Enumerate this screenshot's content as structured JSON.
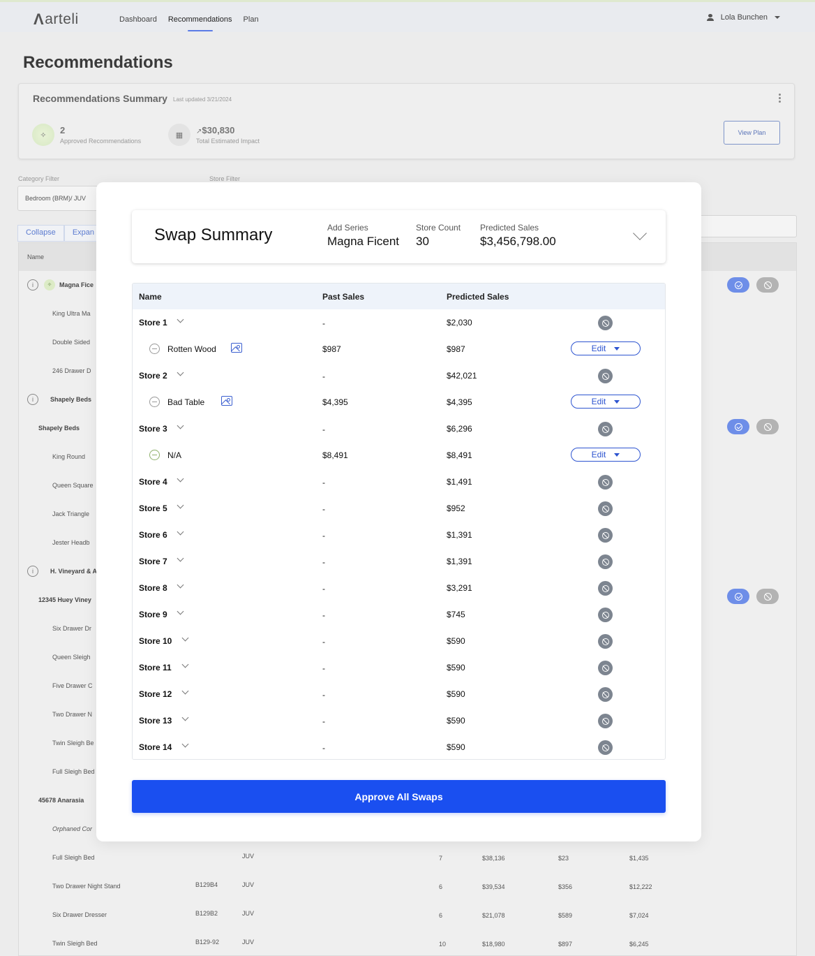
{
  "brand": {
    "name": "arteli"
  },
  "nav": {
    "items": [
      "Dashboard",
      "Recommendations",
      "Plan"
    ],
    "active": "Recommendations"
  },
  "user": {
    "name": "Lola Bunchen"
  },
  "page": {
    "title": "Recommendations"
  },
  "summary": {
    "title": "Recommendations Summary",
    "updated": "Last updated 3/21/2024",
    "approved_count": "2",
    "approved_label": "Approved Recommendations",
    "impact_value": "$30,830",
    "impact_label": "Total Estimated Impact",
    "view_plan": "View Plan"
  },
  "filters": {
    "category_label": "Category Filter",
    "category_value": "Bedroom (BRM)/ JUV",
    "store_label": "Store Filter",
    "collapse": "Collapse",
    "expand": "Expan"
  },
  "bg_table": {
    "name_header": "Name",
    "rows": [
      {
        "name": "Magna Fice",
        "style": "group-spark"
      },
      {
        "name": "King Ultra Ma",
        "style": "item"
      },
      {
        "name": "Double Sided",
        "style": "item"
      },
      {
        "name": "246 Drawer D",
        "style": "item"
      },
      {
        "name": "Shapely Beds",
        "style": "group"
      },
      {
        "name": "Shapely Beds",
        "style": "sub"
      },
      {
        "name": "King Round",
        "style": "item"
      },
      {
        "name": "Queen Square",
        "style": "item"
      },
      {
        "name": "Jack Triangle",
        "style": "item"
      },
      {
        "name": "Jester Headb",
        "style": "item"
      },
      {
        "name": "H. Vineyard & A",
        "style": "group"
      },
      {
        "name": "12345 Huey Viney",
        "style": "sub"
      },
      {
        "name": "Six Drawer Dr",
        "style": "item"
      },
      {
        "name": "Queen Sleigh",
        "style": "item"
      },
      {
        "name": "Five Drawer C",
        "style": "item"
      },
      {
        "name": "Two Drawer N",
        "style": "item"
      },
      {
        "name": "Twin Sleigh Be",
        "style": "item"
      },
      {
        "name": "Full Sleigh Bed",
        "style": "item"
      },
      {
        "name": "45678 Anarasia",
        "style": "sub"
      },
      {
        "name": "Orphaned Cor",
        "style": "italic"
      },
      {
        "name": "Full Sleigh Bed",
        "style": "item",
        "sku": "",
        "cat": "JUV",
        "stores": "7",
        "sales": "$38,136",
        "price": "$23",
        "impact": "$1,435"
      },
      {
        "name": "Two Drawer Night Stand",
        "style": "item",
        "sku": "B129B4",
        "cat": "JUV",
        "stores": "6",
        "sales": "$39,534",
        "price": "$356",
        "impact": "$12,222"
      },
      {
        "name": "Six Drawer Dresser",
        "style": "item",
        "sku": "B129B2",
        "cat": "JUV",
        "stores": "6",
        "sales": "$21,078",
        "price": "$589",
        "impact": "$7,024"
      },
      {
        "name": "Twin Sleigh Bed",
        "style": "item",
        "sku": "B129-92",
        "cat": "JUV",
        "stores": "10",
        "sales": "$18,980",
        "price": "$897",
        "impact": "$6,245"
      }
    ]
  },
  "swap": {
    "title": "Swap Summary",
    "add_series_label": "Add Series",
    "add_series_value": "Magna Ficent",
    "store_count_label": "Store Count",
    "store_count_value": "30",
    "predicted_label": "Predicted Sales",
    "predicted_value": "$3,456,798.00",
    "columns": {
      "name": "Name",
      "past": "Past Sales",
      "predicted": "Predicted Sales"
    },
    "edit_label": "Edit",
    "rows": [
      {
        "type": "store",
        "name": "Store 1",
        "past": "-",
        "predicted": "$2,030"
      },
      {
        "type": "item",
        "name": "Rotten Wood",
        "past": "$987",
        "predicted": "$987",
        "image": true,
        "marker": "gray"
      },
      {
        "type": "store",
        "name": "Store 2",
        "past": "-",
        "predicted": "$42,021"
      },
      {
        "type": "item",
        "name": "Bad Table",
        "past": "$4,395",
        "predicted": "$4,395",
        "image": true,
        "marker": "gray"
      },
      {
        "type": "store",
        "name": "Store 3",
        "past": "-",
        "predicted": "$6,296"
      },
      {
        "type": "item",
        "name": "N/A",
        "past": "$8,491",
        "predicted": "$8,491",
        "image": false,
        "marker": "green"
      },
      {
        "type": "store",
        "name": "Store 4",
        "past": "-",
        "predicted": "$1,491"
      },
      {
        "type": "store",
        "name": "Store 5",
        "past": "-",
        "predicted": "$952"
      },
      {
        "type": "store",
        "name": "Store 6",
        "past": "-",
        "predicted": "$1,391"
      },
      {
        "type": "store",
        "name": "Store 7",
        "past": "-",
        "predicted": "$1,391"
      },
      {
        "type": "store",
        "name": "Store 8",
        "past": "-",
        "predicted": "$3,291"
      },
      {
        "type": "store",
        "name": "Store 9",
        "past": "-",
        "predicted": "$745"
      },
      {
        "type": "store",
        "name": "Store 10",
        "past": "-",
        "predicted": "$590"
      },
      {
        "type": "store",
        "name": "Store 11",
        "past": "-",
        "predicted": "$590"
      },
      {
        "type": "store",
        "name": "Store 12",
        "past": "-",
        "predicted": "$590"
      },
      {
        "type": "store",
        "name": "Store 13",
        "past": "-",
        "predicted": "$590"
      },
      {
        "type": "store",
        "name": "Store 14",
        "past": "-",
        "predicted": "$590"
      }
    ],
    "approve_label": "Approve All Swaps"
  },
  "colors": {
    "primary": "#1a4ff0",
    "accent_blue": "#6e8ee8",
    "muted_gray": "#7d8590"
  }
}
